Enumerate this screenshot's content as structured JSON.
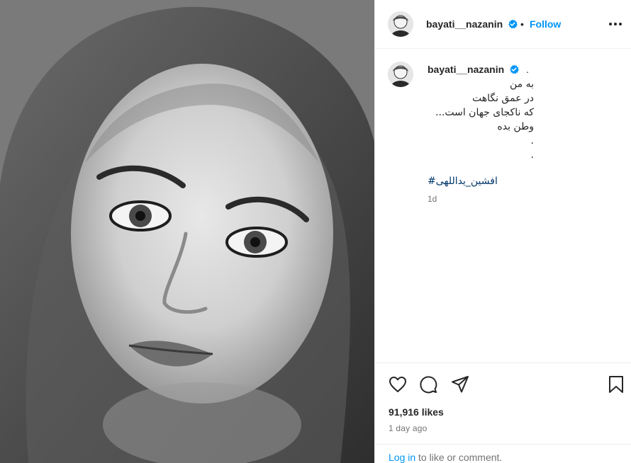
{
  "post": {
    "image_alt": "Black and white portrait of a woman wearing a sheer headscarf"
  },
  "header": {
    "username": "bayati__nazanin",
    "separator": "•",
    "follow_label": "Follow",
    "more_icon": "more-horizontal-icon"
  },
  "caption": {
    "username": "bayati__nazanin",
    "trailing_dot": ".",
    "lines": [
      "به من",
      "در عمق نگاهت",
      "که ناکجای جهان است...",
      "وطن بده",
      ".",
      "."
    ],
    "hashtag": "#افشین_یداللهی",
    "time": "1d"
  },
  "actions": {
    "like_icon": "heart-icon",
    "comment_icon": "comment-icon",
    "share_icon": "send-icon",
    "save_icon": "bookmark-icon"
  },
  "stats": {
    "likes": "91,916 likes",
    "posted": "1 day ago"
  },
  "login": {
    "link": "Log in",
    "text": " to like or comment."
  },
  "colors": {
    "link_blue": "#0095f6",
    "hashtag": "#00376b",
    "muted": "#737373",
    "verified": "#0095f6"
  }
}
